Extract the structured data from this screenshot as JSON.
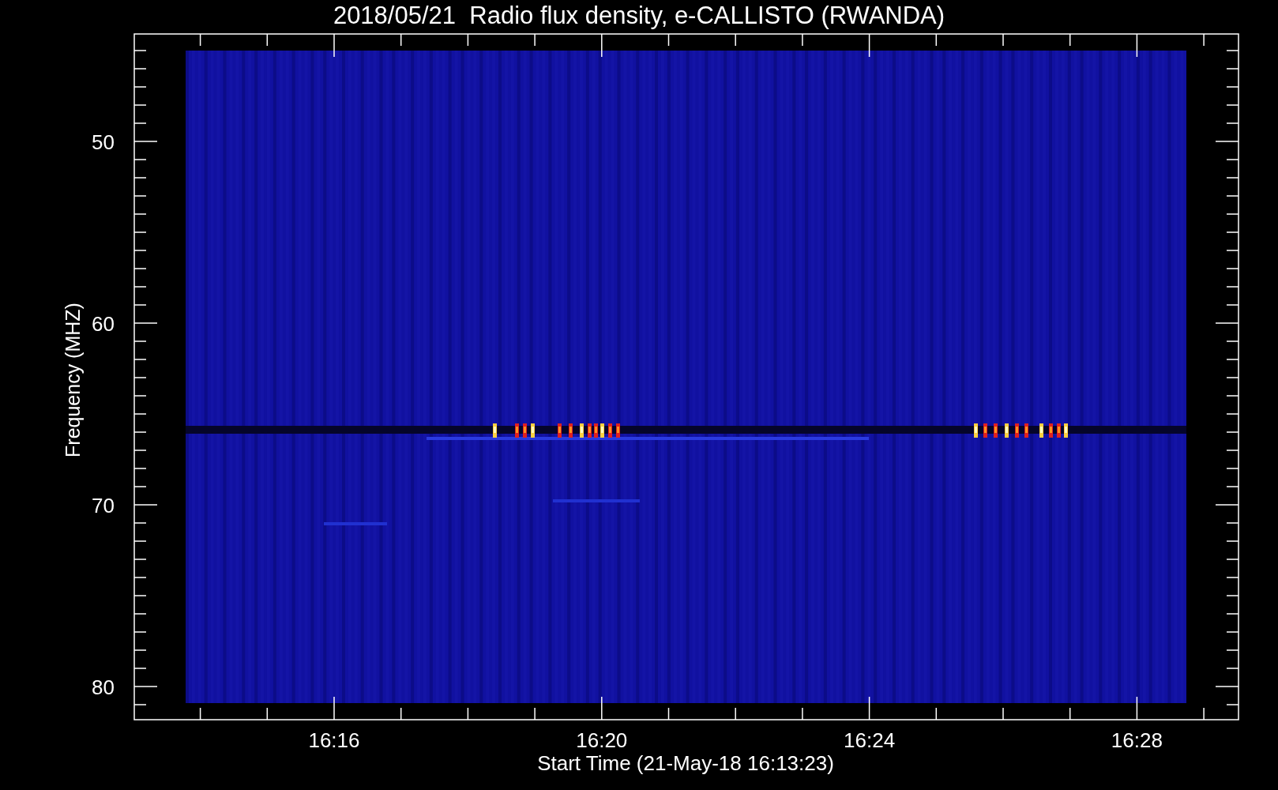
{
  "title": "2018/05/21  Radio flux density, e-CALLISTO (RWANDA)",
  "y_axis": {
    "label": "Frequency (MHZ)",
    "ticks": [
      "50",
      "60",
      "70",
      "80"
    ]
  },
  "x_axis": {
    "label": "Start Time (21-May-18 16:13:23)",
    "ticks": [
      "16:16",
      "16:20",
      "16:24",
      "16:28"
    ]
  }
}
